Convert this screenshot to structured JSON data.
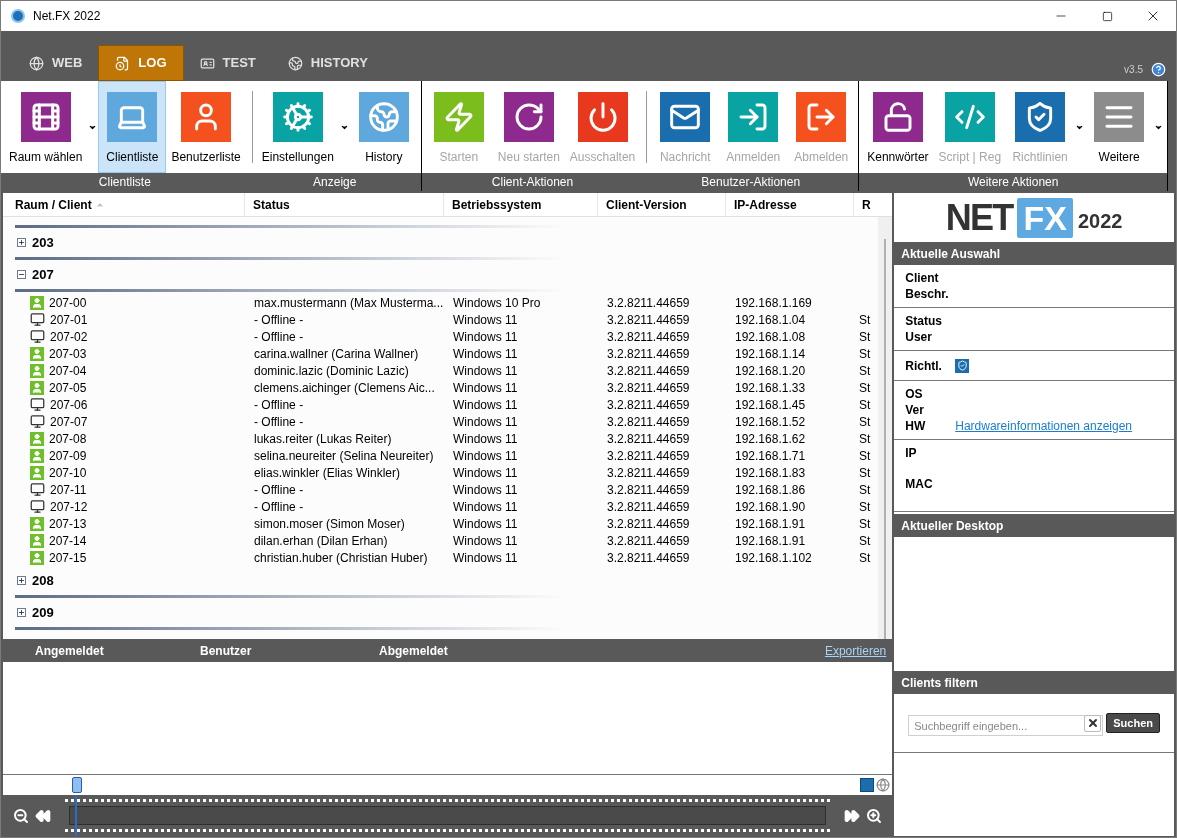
{
  "window": {
    "title": "Net.FX 2022"
  },
  "tabs": [
    {
      "label": "WEB",
      "selected": false
    },
    {
      "label": "LOG",
      "selected": true
    },
    {
      "label": "TEST",
      "selected": false
    },
    {
      "label": "HISTORY",
      "selected": false
    }
  ],
  "version": "v3.5",
  "ribbon": [
    {
      "label": "Clientliste",
      "buttons": [
        {
          "label": "Raum wählen",
          "color": "#8e2a8e",
          "disabled": false,
          "selected": false,
          "dropdown": true
        },
        {
          "label": "Clientliste",
          "color": "#5ea8dd",
          "disabled": false,
          "selected": true,
          "dropdown": false
        },
        {
          "label": "Benutzerliste",
          "color": "#f4511e",
          "disabled": false,
          "selected": false,
          "dropdown": false
        }
      ]
    },
    {
      "label": "Anzeige",
      "buttons": [
        {
          "label": "Einstellungen",
          "color": "#0aa3a3",
          "disabled": false,
          "selected": false,
          "dropdown": true
        },
        {
          "label": "History",
          "color": "#5ea8dd",
          "disabled": false,
          "selected": false,
          "dropdown": false
        }
      ]
    },
    {
      "label": "Client-Aktionen",
      "buttons": [
        {
          "label": "Starten",
          "color": "#7cbd1e",
          "disabled": true,
          "selected": false,
          "dropdown": false
        },
        {
          "label": "Neu starten",
          "color": "#8e2a8e",
          "disabled": true,
          "selected": false,
          "dropdown": false
        },
        {
          "label": "Ausschalten",
          "color": "#e8391f",
          "disabled": true,
          "selected": false,
          "dropdown": false
        }
      ]
    },
    {
      "label": "Benutzer-Aktionen",
      "buttons": [
        {
          "label": "Nachricht",
          "color": "#1a6eae",
          "disabled": true,
          "selected": false,
          "dropdown": false
        },
        {
          "label": "Anmelden",
          "color": "#0aa3a3",
          "disabled": true,
          "selected": false,
          "dropdown": false
        },
        {
          "label": "Abmelden",
          "color": "#f4511e",
          "disabled": true,
          "selected": false,
          "dropdown": false
        }
      ]
    },
    {
      "label": "Weitere Aktionen",
      "buttons": [
        {
          "label": "Kennwörter",
          "color": "#8e2a8e",
          "disabled": false,
          "selected": false,
          "dropdown": false
        },
        {
          "label": "Script | Reg",
          "color": "#0aa3a3",
          "disabled": true,
          "selected": false,
          "dropdown": false
        },
        {
          "label": "Richtlinien",
          "color": "#1a6eae",
          "disabled": true,
          "selected": false,
          "dropdown": true
        },
        {
          "label": "Weitere",
          "color": "#8c8c8c",
          "disabled": false,
          "selected": false,
          "dropdown": true
        }
      ]
    }
  ],
  "table": {
    "columns": [
      {
        "label": "Raum / Client",
        "sorted": true
      },
      {
        "label": "Status",
        "sorted": false
      },
      {
        "label": "Betriebssystem",
        "sorted": false
      },
      {
        "label": "Client-Version",
        "sorted": false
      },
      {
        "label": "IP-Adresse",
        "sorted": false
      },
      {
        "label": "R",
        "sorted": false
      }
    ],
    "groups": [
      {
        "name": "203",
        "expanded": false
      },
      {
        "name": "207",
        "expanded": true,
        "clients": [
          {
            "name": "207-00",
            "online": true,
            "status": "max.mustermann (Max Musterma...",
            "os": "Windows 10 Pro",
            "version": "3.2.8211.44659",
            "ip": "192.168.1.169"
          },
          {
            "name": "207-01",
            "online": false,
            "status": "- Offline -",
            "os": "Windows 11",
            "version": "3.2.8211.44659",
            "ip": "192.168.1.04",
            "column_6": "St"
          },
          {
            "name": "207-02",
            "online": false,
            "status": "- Offline -",
            "os": "Windows 11",
            "version": "3.2.8211.44659",
            "ip": "192.168.1.08",
            "column_6": "St"
          },
          {
            "name": "207-03",
            "online": true,
            "status": "carina.wallner (Carina Wallner)",
            "os": "Windows 11",
            "version": "3.2.8211.44659",
            "ip": "192.168.1.14",
            "column_6": "St"
          },
          {
            "name": "207-04",
            "online": true,
            "status": "dominic.lazic (Dominic Lazic)",
            "os": "Windows 11",
            "version": "3.2.8211.44659",
            "ip": "192.168.1.20",
            "column_6": "St"
          },
          {
            "name": "207-05",
            "online": true,
            "status": "clemens.aichinger (Clemens Aic...",
            "os": "Windows 11",
            "version": "3.2.8211.44659",
            "ip": "192.168.1.33",
            "column_6": "St"
          },
          {
            "name": "207-06",
            "online": false,
            "status": "- Offline -",
            "os": "Windows 11",
            "version": "3.2.8211.44659",
            "ip": "192.168.1.45",
            "column_6": "St"
          },
          {
            "name": "207-07",
            "online": false,
            "status": "- Offline -",
            "os": "Windows 11",
            "version": "3.2.8211.44659",
            "ip": "192.168.1.52",
            "column_6": "St"
          },
          {
            "name": "207-08",
            "online": true,
            "status": "lukas.reiter (Lukas Reiter)",
            "os": "Windows 11",
            "version": "3.2.8211.44659",
            "ip": "192.168.1.62",
            "column_6": "St"
          },
          {
            "name": "207-09",
            "online": true,
            "status": "selina.neureiter (Selina Neureiter)",
            "os": "Windows 11",
            "version": "3.2.8211.44659",
            "ip": "192.168.1.71",
            "column_6": "St"
          },
          {
            "name": "207-10",
            "online": true,
            "status": "elias.winkler (Elias Winkler)",
            "os": "Windows 11",
            "version": "3.2.8211.44659",
            "ip": "192.168.1.83",
            "column_6": "St"
          },
          {
            "name": "207-11",
            "online": false,
            "status": "- Offline -",
            "os": "Windows 11",
            "version": "3.2.8211.44659",
            "ip": "192.168.1.86",
            "column_6": "St"
          },
          {
            "name": "207-12",
            "online": false,
            "status": "- Offline -",
            "os": "Windows 11",
            "version": "3.2.8211.44659",
            "ip": "192.168.1.90",
            "column_6": "St"
          },
          {
            "name": "207-13",
            "online": true,
            "status": "simon.moser (Simon Moser)",
            "os": "Windows 11",
            "version": "3.2.8211.44659",
            "ip": "192.168.1.91",
            "column_6": "St"
          },
          {
            "name": "207-14",
            "online": true,
            "status": "dilan.erhan (Dilan Erhan)",
            "os": "Windows 11",
            "version": "3.2.8211.44659",
            "ip": "192.168.1.91",
            "column_6": "St"
          },
          {
            "name": "207-15",
            "online": true,
            "status": "christian.huber (Christian Huber)",
            "os": "Windows 11",
            "version": "3.2.8211.44659",
            "ip": "192.168.1.102",
            "column_6": "St"
          }
        ]
      },
      {
        "name": "208",
        "expanded": false
      },
      {
        "name": "209",
        "expanded": false
      }
    ]
  },
  "log": {
    "columns": [
      "Angemeldet",
      "Benutzer",
      "Abgemeldet"
    ],
    "export_link": "Exportieren"
  },
  "logo": {
    "part_1": "NET",
    "part_2": "FX",
    "part_3": "2022"
  },
  "selection": {
    "title": "Aktuelle Auswahl",
    "sections": [
      [
        {
          "label": "Client",
          "kind": "plain"
        },
        {
          "label": "Beschr.",
          "kind": "plain"
        }
      ],
      [
        {
          "label": "Status",
          "kind": "plain"
        },
        {
          "label": "User",
          "kind": "plain"
        }
      ],
      [
        {
          "label": "Richtl.",
          "kind": "badge"
        }
      ],
      [
        {
          "label": "OS",
          "kind": "plain"
        },
        {
          "label": "Ver",
          "kind": "plain"
        },
        {
          "label": "HW",
          "kind": "link",
          "link": "Hardwareinformationen anzeigen"
        }
      ],
      [
        {
          "label": "IP",
          "kind": "plain"
        },
        {
          "label": "MAC",
          "kind": "spaced"
        }
      ]
    ]
  },
  "desktop": {
    "title": "Aktueller Desktop"
  },
  "filter": {
    "title": "Clients filtern",
    "placeholder": "Suchbegriff eingeben...",
    "button": "Suchen"
  }
}
